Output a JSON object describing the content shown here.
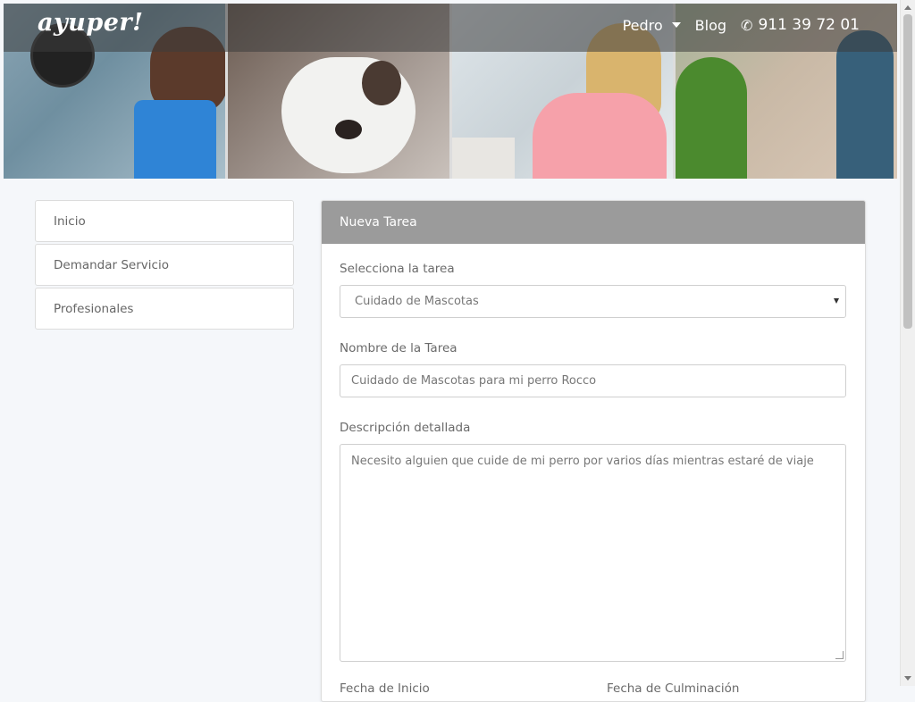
{
  "brand": {
    "logo_text": "ayuper!"
  },
  "nav": {
    "user_label": "Pedro",
    "blog_label": "Blog",
    "phone": "911 39 72 01"
  },
  "sidebar": {
    "items": [
      {
        "label": "Inicio"
      },
      {
        "label": "Demandar Servicio"
      },
      {
        "label": "Profesionales"
      }
    ]
  },
  "form": {
    "heading": "Nueva Tarea",
    "task_select": {
      "label": "Selecciona la tarea",
      "value": "Cuidado de Mascotas"
    },
    "task_name": {
      "label": "Nombre de la Tarea",
      "value": "Cuidado de Mascotas para mi perro Rocco"
    },
    "description": {
      "label": "Descripción detallada",
      "value": "Necesito alguien que cuide de mi perro por varios días mientras estaré de viaje"
    },
    "start_date": {
      "label": "Fecha de Inicio"
    },
    "end_date": {
      "label": "Fecha de Culminación"
    }
  },
  "icons": {
    "nav_dropdown": "caret-down-icon",
    "phone": "phone-icon",
    "select_arrow": "caret-down-icon",
    "textarea_resize": "resize-grip-icon"
  }
}
